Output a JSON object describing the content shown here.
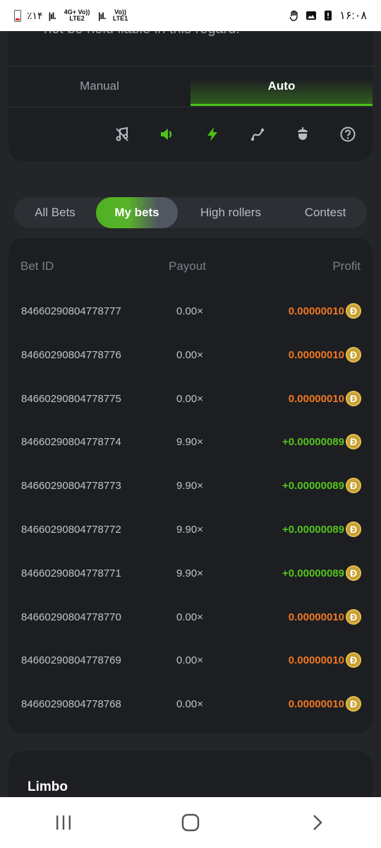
{
  "status_bar": {
    "battery_text": "٪۱۴",
    "network1": "4G+ Vo)) LTE2",
    "network2": "Vo)) LTE1",
    "time": "۱۶:۰۸"
  },
  "top": {
    "cut_text": "not be held liable in this regard.",
    "tabs": [
      {
        "label": "Manual",
        "active": false
      },
      {
        "label": "Auto",
        "active": true
      }
    ],
    "tool_icons": [
      "music-off-icon",
      "sound-icon",
      "lightning-icon",
      "graph-icon",
      "acorn-icon",
      "help-icon"
    ],
    "accent_color": "#4cc21a"
  },
  "segments": [
    {
      "label": "All Bets",
      "active": false
    },
    {
      "label": "My bets",
      "active": true
    },
    {
      "label": "High rollers",
      "active": false
    },
    {
      "label": "Contest",
      "active": false
    }
  ],
  "table": {
    "headers": {
      "bet_id": "Bet ID",
      "payout": "Payout",
      "profit": "Profit"
    },
    "rows": [
      {
        "id": "84660290804778777",
        "payout": "0.00×",
        "profit": "0.00000010",
        "positive": false
      },
      {
        "id": "84660290804778776",
        "payout": "0.00×",
        "profit": "0.00000010",
        "positive": false
      },
      {
        "id": "84660290804778775",
        "payout": "0.00×",
        "profit": "0.00000010",
        "positive": false
      },
      {
        "id": "84660290804778774",
        "payout": "9.90×",
        "profit": "+0.00000089",
        "positive": true
      },
      {
        "id": "84660290804778773",
        "payout": "9.90×",
        "profit": "+0.00000089",
        "positive": true
      },
      {
        "id": "84660290804778772",
        "payout": "9.90×",
        "profit": "+0.00000089",
        "positive": true
      },
      {
        "id": "84660290804778771",
        "payout": "9.90×",
        "profit": "+0.00000089",
        "positive": true
      },
      {
        "id": "84660290804778770",
        "payout": "0.00×",
        "profit": "0.00000010",
        "positive": false
      },
      {
        "id": "84660290804778769",
        "payout": "0.00×",
        "profit": "0.00000010",
        "positive": false
      },
      {
        "id": "84660290804778768",
        "payout": "0.00×",
        "profit": "0.00000010",
        "positive": false
      }
    ],
    "coin_symbol": "Ð",
    "negative_color": "#f07821",
    "positive_color": "#55c41c"
  },
  "limbo": {
    "title": "Limbo"
  }
}
